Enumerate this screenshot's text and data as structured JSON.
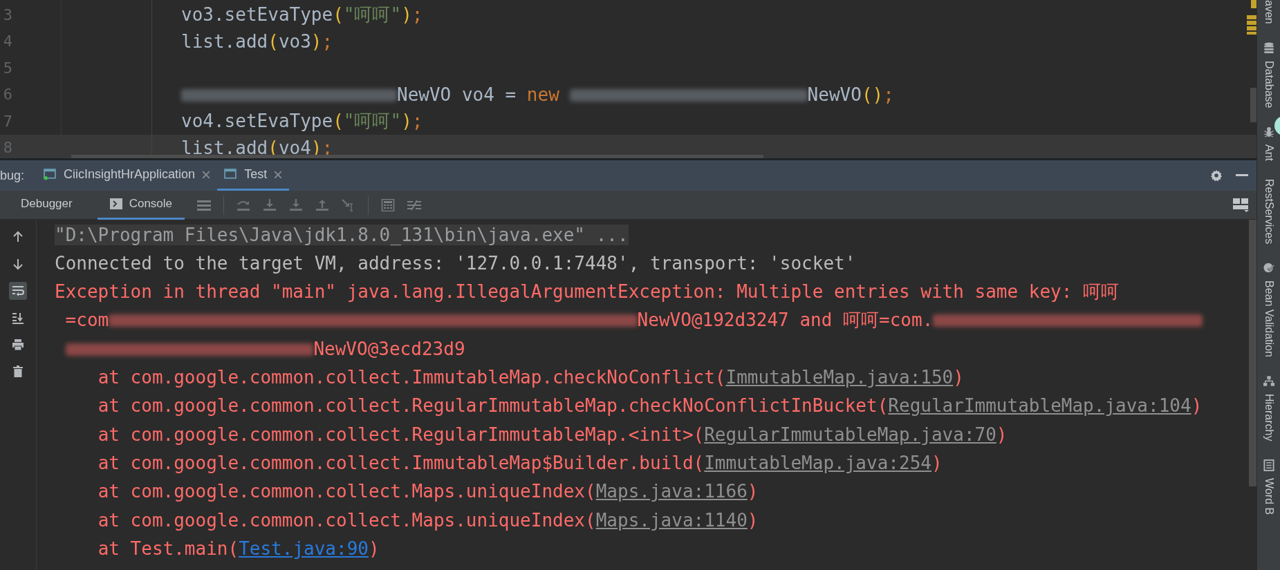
{
  "editor": {
    "lines": [
      {
        "number": "3",
        "current": false,
        "tokens": [
          {
            "kind": "plain",
            "text": "vo3.setEvaType"
          },
          {
            "kind": "paren",
            "text": "("
          },
          {
            "kind": "string",
            "text": "\"呵呵\""
          },
          {
            "kind": "paren",
            "text": ")"
          },
          {
            "kind": "punct",
            "text": ";"
          }
        ]
      },
      {
        "number": "4",
        "current": false,
        "tokens": [
          {
            "kind": "plain",
            "text": "list.add"
          },
          {
            "kind": "paren",
            "text": "("
          },
          {
            "kind": "plain",
            "text": "vo3"
          },
          {
            "kind": "paren",
            "text": ")"
          },
          {
            "kind": "punct",
            "text": ";"
          }
        ]
      },
      {
        "number": "5",
        "current": false
      },
      {
        "number": "6",
        "current": false,
        "tokens": [
          {
            "kind": "blurred"
          },
          {
            "kind": "plain",
            "text": "NewVO vo4 = "
          },
          {
            "kind": "keyword",
            "text": "new"
          },
          {
            "kind": "space"
          },
          {
            "kind": "blurred"
          },
          {
            "kind": "plain",
            "text": "NewVO"
          },
          {
            "kind": "paren",
            "text": "()"
          },
          {
            "kind": "punct",
            "text": ";"
          }
        ]
      },
      {
        "number": "7",
        "current": false,
        "tokens": [
          {
            "kind": "plain",
            "text": "vo4.setEvaType"
          },
          {
            "kind": "paren",
            "text": "("
          },
          {
            "kind": "string",
            "text": "\"呵呵\""
          },
          {
            "kind": "paren",
            "text": ")"
          },
          {
            "kind": "punct",
            "text": ";"
          }
        ]
      },
      {
        "number": "8",
        "current": true,
        "tokens": [
          {
            "kind": "plain",
            "text": "list.add"
          },
          {
            "kind": "paren",
            "text": "("
          },
          {
            "kind": "plain",
            "text": "vo4"
          },
          {
            "kind": "paren",
            "text": ")"
          },
          {
            "kind": "punct",
            "text": ";"
          }
        ]
      }
    ]
  },
  "debug_panel": {
    "label": "bug:",
    "tabs": [
      {
        "title": "CiicInsightHrApplication",
        "selected": false,
        "running": true
      },
      {
        "title": "Test",
        "selected": true,
        "running": false
      }
    ],
    "sub_tabs": [
      {
        "label": "Debugger",
        "kind": "debugger",
        "selected": false
      },
      {
        "label": "Console",
        "kind": "console",
        "selected": true
      }
    ]
  },
  "console": {
    "gutter_buttons": [
      {
        "kind": "up",
        "selected": false
      },
      {
        "kind": "down",
        "selected": false
      },
      {
        "kind": "wrap",
        "selected": true
      },
      {
        "kind": "scroll-end",
        "selected": false
      },
      {
        "kind": "print",
        "selected": false
      },
      {
        "kind": "trash",
        "selected": false
      }
    ],
    "lines": [
      {
        "kind": "command",
        "wrapped": false,
        "segments": [
          {
            "kind": "text",
            "text": "\"D:\\Program Files\\Java\\jdk1.8.0_131\\bin\\java.exe\" ..."
          }
        ]
      },
      {
        "kind": "info",
        "wrapped": false,
        "segments": [
          {
            "kind": "text",
            "text": "Connected to the target VM, address: '127.0.0.1:7448', transport: 'socket'"
          }
        ]
      },
      {
        "kind": "error",
        "wrapped": false,
        "segments": [
          {
            "kind": "text",
            "text": "Exception in thread \"main\" java.lang.IllegalArgumentException: Multiple entries with same key: 呵呵"
          }
        ]
      },
      {
        "kind": "error",
        "wrapped": true,
        "segments": [
          {
            "kind": "text",
            "text": "=com"
          },
          {
            "kind": "blurred"
          },
          {
            "kind": "text",
            "text": "NewVO@192d3247 and 呵呵=com."
          },
          {
            "kind": "blurred"
          }
        ]
      },
      {
        "kind": "error",
        "wrapped": true,
        "segments": [
          {
            "kind": "blurred"
          },
          {
            "kind": "text",
            "text": "NewVO@3ecd23d9"
          }
        ]
      },
      {
        "kind": "error",
        "wrapped": false,
        "segments": [
          {
            "kind": "text",
            "text": "\tat com.google.common.collect.ImmutableMap.checkNoConflict("
          },
          {
            "kind": "link",
            "text": "ImmutableMap.java:150"
          },
          {
            "kind": "text",
            "text": ")"
          }
        ]
      },
      {
        "kind": "error",
        "wrapped": false,
        "segments": [
          {
            "kind": "text",
            "text": "\tat com.google.common.collect.RegularImmutableMap.checkNoConflictInBucket("
          },
          {
            "kind": "link",
            "text": "RegularImmutableMap.java:104"
          },
          {
            "kind": "text",
            "text": ")"
          }
        ]
      },
      {
        "kind": "error",
        "wrapped": false,
        "segments": [
          {
            "kind": "text",
            "text": "\tat com.google.common.collect.RegularImmutableMap.<init>("
          },
          {
            "kind": "link",
            "text": "RegularImmutableMap.java:70"
          },
          {
            "kind": "text",
            "text": ")"
          }
        ]
      },
      {
        "kind": "error",
        "wrapped": false,
        "segments": [
          {
            "kind": "text",
            "text": "\tat com.google.common.collect.ImmutableMap$Builder.build("
          },
          {
            "kind": "link",
            "text": "ImmutableMap.java:254"
          },
          {
            "kind": "text",
            "text": ")"
          }
        ]
      },
      {
        "kind": "error",
        "wrapped": false,
        "segments": [
          {
            "kind": "text",
            "text": "\tat com.google.common.collect.Maps.uniqueIndex("
          },
          {
            "kind": "link",
            "text": "Maps.java:1166"
          },
          {
            "kind": "text",
            "text": ")"
          }
        ]
      },
      {
        "kind": "error",
        "wrapped": false,
        "segments": [
          {
            "kind": "text",
            "text": "\tat com.google.common.collect.Maps.uniqueIndex("
          },
          {
            "kind": "link",
            "text": "Maps.java:1140"
          },
          {
            "kind": "text",
            "text": ")"
          }
        ]
      },
      {
        "kind": "error",
        "wrapped": false,
        "segments": [
          {
            "kind": "text",
            "text": "\tat Test.main("
          },
          {
            "kind": "project_link",
            "text": "Test.java:90"
          },
          {
            "kind": "text",
            "text": ")"
          }
        ]
      }
    ]
  },
  "tool_strip": [
    {
      "label": "aven"
    },
    {
      "label": "Database"
    },
    {
      "label": "Ant"
    },
    {
      "label": "RestServices"
    },
    {
      "label": "Bean Validation"
    },
    {
      "label": "Hierarchy"
    },
    {
      "label": "Word B"
    }
  ]
}
